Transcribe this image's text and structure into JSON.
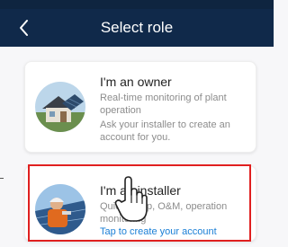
{
  "header": {
    "title": "Select role",
    "back_icon": "chevron-left-icon"
  },
  "colors": {
    "header_bg": "#10294a",
    "link": "#1a7fd6",
    "highlight_border": "#e02020"
  },
  "roles": {
    "owner": {
      "title": "I'm an owner",
      "desc1": "Real-time monitoring of plant operation",
      "desc2": "Ask your installer to create an account for you.",
      "icon": "house-solar-avatar"
    },
    "installer": {
      "title": "I'm an installer",
      "desc": "Quick setup, O&M, operation monitoring",
      "cta": "Tap to create your account",
      "icon": "installer-worker-avatar"
    }
  },
  "overlay": {
    "pointer_icon": "hand-pointer-icon"
  }
}
